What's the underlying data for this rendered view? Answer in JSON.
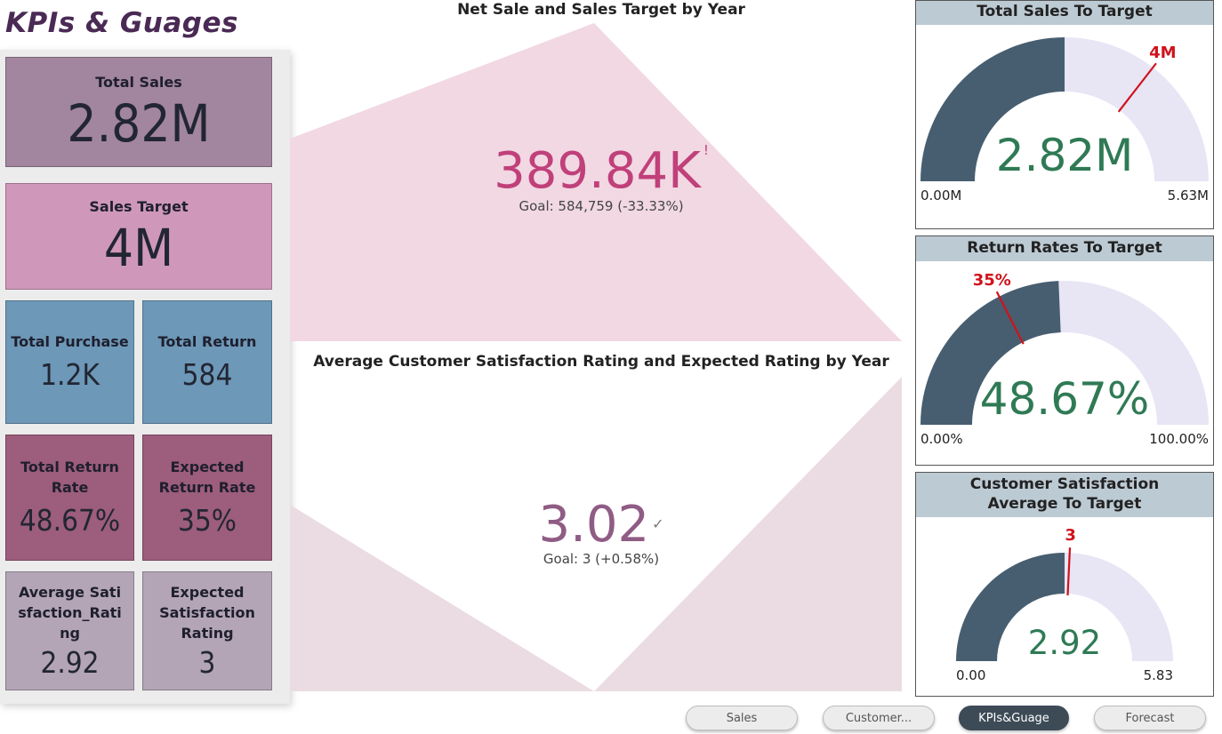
{
  "page": {
    "title": "KPIs & Guages"
  },
  "cards": {
    "total_sales": {
      "label": "Total Sales",
      "value": "2.82M"
    },
    "sales_target": {
      "label": "Sales Target",
      "value": "4M"
    },
    "total_purchase": {
      "label": "Total Purchase",
      "value": "1.2K"
    },
    "total_return": {
      "label": "Total Return",
      "value": "584"
    },
    "total_return_rate": {
      "label": "Total Return Rate",
      "value": "48.67%"
    },
    "expected_return_rate": {
      "label": "Expected Return Rate",
      "value": "35%"
    },
    "avg_satisfaction": {
      "label": "Average Satisfaction_Rating",
      "value": "2.92"
    },
    "expected_satisfaction": {
      "label": "Expected Satisfaction Rating",
      "value": "3"
    }
  },
  "kpi_sales": {
    "title": "Net Sale and Sales Target by Year",
    "value": "389.84K",
    "status_icon": "!",
    "goal": "Goal: 584,759 (-33.33%)",
    "color": "#c0407a"
  },
  "kpi_satisfaction": {
    "title": "Average Customer Satisfaction Rating and Expected Rating by Year",
    "value": "3.02",
    "status_icon": "✓",
    "goal": "Goal: 3 (+0.58%)",
    "color": "#8f5c85"
  },
  "gauges": {
    "sales": {
      "title": "Total Sales To Target",
      "value": "2.82M",
      "min": "0.00M",
      "max": "5.63M",
      "target_label": "4M",
      "fill_fraction": 0.5,
      "target_fraction": 0.71
    },
    "returns": {
      "title": "Return Rates To Target",
      "value": "48.67%",
      "min": "0.00%",
      "max": "100.00%",
      "target_label": "35%",
      "fill_fraction": 0.4867,
      "target_fraction": 0.35
    },
    "satisfaction": {
      "title": "Customer Satisfaction Average To Target",
      "value": "2.92",
      "min": "0.00",
      "max": "5.83",
      "target_label": "3",
      "fill_fraction": 0.5,
      "target_fraction": 0.515
    }
  },
  "nav": {
    "buttons": [
      {
        "label": "Sales",
        "active": false
      },
      {
        "label": "Customer...",
        "active": false
      },
      {
        "label": "KPIs&Guage",
        "active": true
      },
      {
        "label": "Forecast",
        "active": false
      }
    ]
  },
  "colors": {
    "gauge_fill": "#475e70",
    "gauge_track": "#e8e5f5",
    "gauge_value": "#2f7a55",
    "target_line": "#d0121b"
  }
}
